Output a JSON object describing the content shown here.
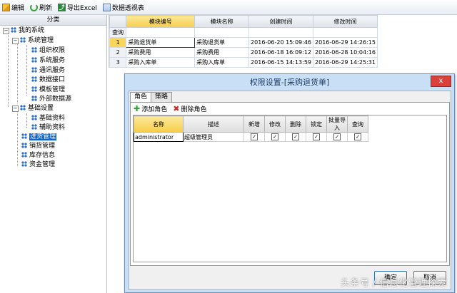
{
  "toolbar": {
    "edit": "编辑",
    "refresh": "刷新",
    "export": "导出Excel",
    "pivot": "数据透视表"
  },
  "tree": {
    "header": "分类",
    "root": "我的系统",
    "nodes": [
      {
        "label": "系统管理"
      },
      {
        "label": "组织权限"
      },
      {
        "label": "系统服务"
      },
      {
        "label": "通讯服务"
      },
      {
        "label": "数据接口"
      },
      {
        "label": "模板管理"
      },
      {
        "label": "外部数据源"
      },
      {
        "label": "基础设置"
      },
      {
        "label": "基础资料"
      },
      {
        "label": "辅助资料"
      },
      {
        "label": "进货管理"
      },
      {
        "label": "销货管理"
      },
      {
        "label": "库存信息"
      },
      {
        "label": "资金管理"
      }
    ]
  },
  "module_grid": {
    "columns": [
      "模块编号",
      "模块名称",
      "创建时间",
      "修改时间"
    ],
    "query_label": "查询",
    "rows": [
      {
        "num": "1",
        "code": "采购退货单",
        "name": "采购退货单",
        "created": "2016-06-20 15:09:46",
        "modified": "2016-06-29 14:26:15"
      },
      {
        "num": "2",
        "code": "采购费用",
        "name": "采购费用",
        "created": "2016-06-18 16:09:12",
        "modified": "2016-06-28 10:04:16"
      },
      {
        "num": "3",
        "code": "采购入库单",
        "name": "采购入库单",
        "created": "2016-06-15 14:13:59",
        "modified": "2016-06-29 14:25:31"
      }
    ]
  },
  "dialog": {
    "title": "权限设置-[采购退货单]",
    "close": "x",
    "tabs": [
      "角色",
      "策略"
    ],
    "add_role": "添加角色",
    "delete_role": "删除角色",
    "columns": [
      "名称",
      "描述",
      "新增",
      "修改",
      "删除",
      "锁定",
      "批量导入",
      "查询"
    ],
    "rows": [
      {
        "name": "administrator",
        "desc": "超级管理员",
        "checks": [
          "✓",
          "✓",
          "✓",
          "✓",
          "✓",
          "✓"
        ]
      }
    ],
    "ok": "确定",
    "cancel": "取消"
  },
  "watermark": "头条号 / 信息化管理探索"
}
